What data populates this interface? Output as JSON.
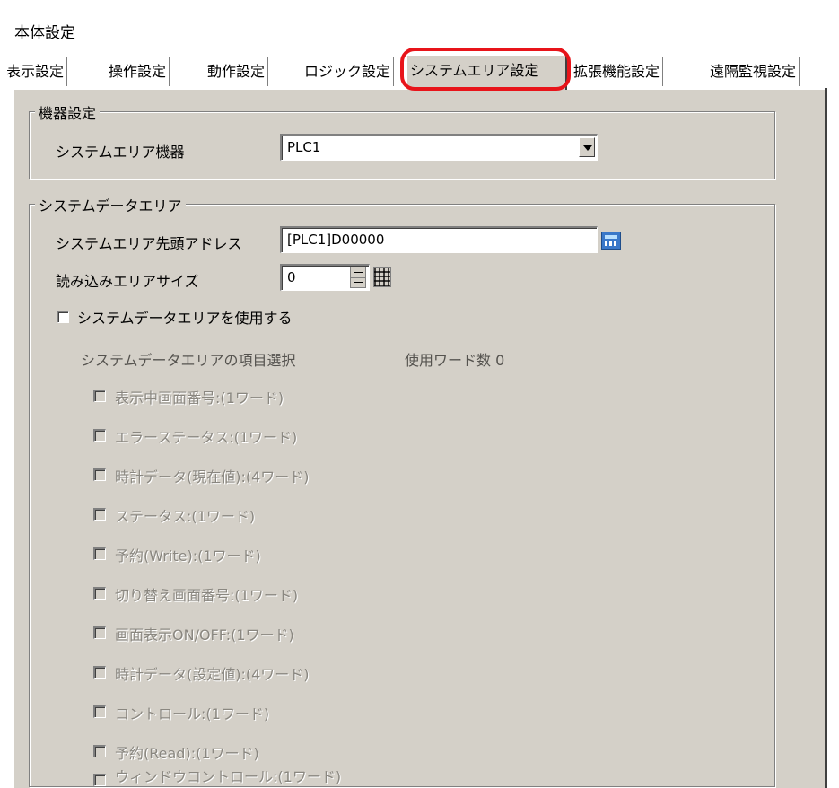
{
  "window": {
    "title": "本体設定"
  },
  "tabs": [
    {
      "label": "表示設定"
    },
    {
      "label": "操作設定"
    },
    {
      "label": "動作設定"
    },
    {
      "label": "ロジック設定"
    },
    {
      "label": "システムエリア設定"
    },
    {
      "label": "拡張機能設定"
    },
    {
      "label": "遠隔監視設定"
    }
  ],
  "device_group": {
    "title": "機器設定",
    "device_label": "システムエリア機器",
    "device_value": "PLC1"
  },
  "system_data_group": {
    "title": "システムデータエリア",
    "start_address_label": "システムエリア先頭アドレス",
    "start_address_value": "[PLC1]D00000",
    "read_size_label": "読み込みエリアサイズ",
    "read_size_value": "0",
    "use_checkbox_label": "システムデータエリアを使用する",
    "item_select_label": "システムデータエリアの項目選択",
    "word_count_label": "使用ワード数 0",
    "items": [
      {
        "label": "表示中画面番号:(1ワード)"
      },
      {
        "label": "エラーステータス:(1ワード)"
      },
      {
        "label": "時計データ(現在値):(4ワード)"
      },
      {
        "label": "ステータス:(1ワード)"
      },
      {
        "label": "予約(Write):(1ワード)"
      },
      {
        "label": "切り替え画面番号:(1ワード)"
      },
      {
        "label": "画面表示ON/OFF:(1ワード)"
      },
      {
        "label": "時計データ(設定値):(4ワード)"
      },
      {
        "label": "コントロール:(1ワード)"
      },
      {
        "label": "予約(Read):(1ワード)"
      },
      {
        "label": "ウィンドウコントロール:(1ワード)"
      }
    ]
  },
  "colors": {
    "highlight": "#e8141a",
    "panel": "#d4d0c8"
  },
  "icons": {
    "dropdown": "chevron-down-icon",
    "address_picker": "calculator-icon",
    "keypad": "keypad-icon"
  }
}
